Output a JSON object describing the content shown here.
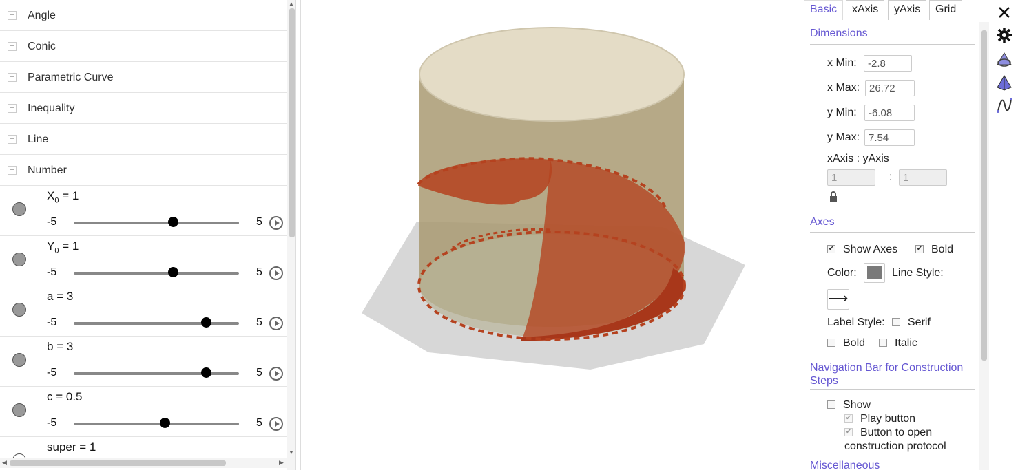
{
  "algebra": {
    "categories": [
      {
        "label": "Angle",
        "toggle": "+"
      },
      {
        "label": "Conic",
        "toggle": "+"
      },
      {
        "label": "Parametric Curve",
        "toggle": "+"
      },
      {
        "label": "Inequality",
        "toggle": "+"
      },
      {
        "label": "Line",
        "toggle": "+"
      },
      {
        "label": "Number",
        "toggle": "−"
      }
    ],
    "numbers": [
      {
        "name": "X",
        "sub": "0",
        "eq": " = 1",
        "min": "-5",
        "max": "5",
        "value": 1,
        "visible": true
      },
      {
        "name": "Y",
        "sub": "0",
        "eq": " = 1",
        "min": "-5",
        "max": "5",
        "value": 1,
        "visible": true
      },
      {
        "name": "a",
        "sub": "",
        "eq": " = 3",
        "min": "-5",
        "max": "5",
        "value": 3,
        "visible": true
      },
      {
        "name": "b",
        "sub": "",
        "eq": " = 3",
        "min": "-5",
        "max": "5",
        "value": 3,
        "visible": true
      },
      {
        "name": "c",
        "sub": "",
        "eq": " = 0.5",
        "min": "-5",
        "max": "5",
        "value": 0.5,
        "visible": true
      },
      {
        "name": "super",
        "sub": "",
        "eq": " = 1",
        "min": "",
        "max": "",
        "value": 1,
        "visible": false
      }
    ]
  },
  "settings": {
    "tabs": [
      "Basic",
      "xAxis",
      "yAxis",
      "Grid"
    ],
    "active_tab": "Basic",
    "dimensions": {
      "heading": "Dimensions",
      "xmin_label": "x Min:",
      "xmin": "-2.8",
      "xmax_label": "x Max:",
      "xmax": "26.72",
      "ymin_label": "y Min:",
      "ymin": "-6.08",
      "ymax_label": "y Max:",
      "ymax": "7.54",
      "ratio_label": "xAxis : yAxis",
      "ratio_x": "1",
      "ratio_sep": ":",
      "ratio_y": "1"
    },
    "axes": {
      "heading": "Axes",
      "show_axes": "Show Axes",
      "bold": "Bold",
      "color_label": "Color:",
      "line_style_label": "Line Style:",
      "line_style_glyph": "⟶",
      "label_style": "Label Style:",
      "serif": "Serif",
      "label_bold": "Bold",
      "italic": "Italic",
      "axis_color": "#7a7a7a"
    },
    "navigation": {
      "heading": "Navigation Bar for Construction Steps",
      "show": "Show",
      "play_button": "Play button",
      "protocol_button_1": "Button to open",
      "protocol_button_2": "construction protocol"
    },
    "misc_heading": "Miscellaneous"
  },
  "colors": {
    "accent": "#6557d2",
    "surface": "#b5421f",
    "cylinder": "#a99a72",
    "cylinder_top": "#e4dcc6",
    "plane": "#d7d7d7"
  },
  "icons": [
    "close-icon",
    "gear-icon",
    "graphics3d-icon",
    "pyramid-icon",
    "function-icon"
  ]
}
